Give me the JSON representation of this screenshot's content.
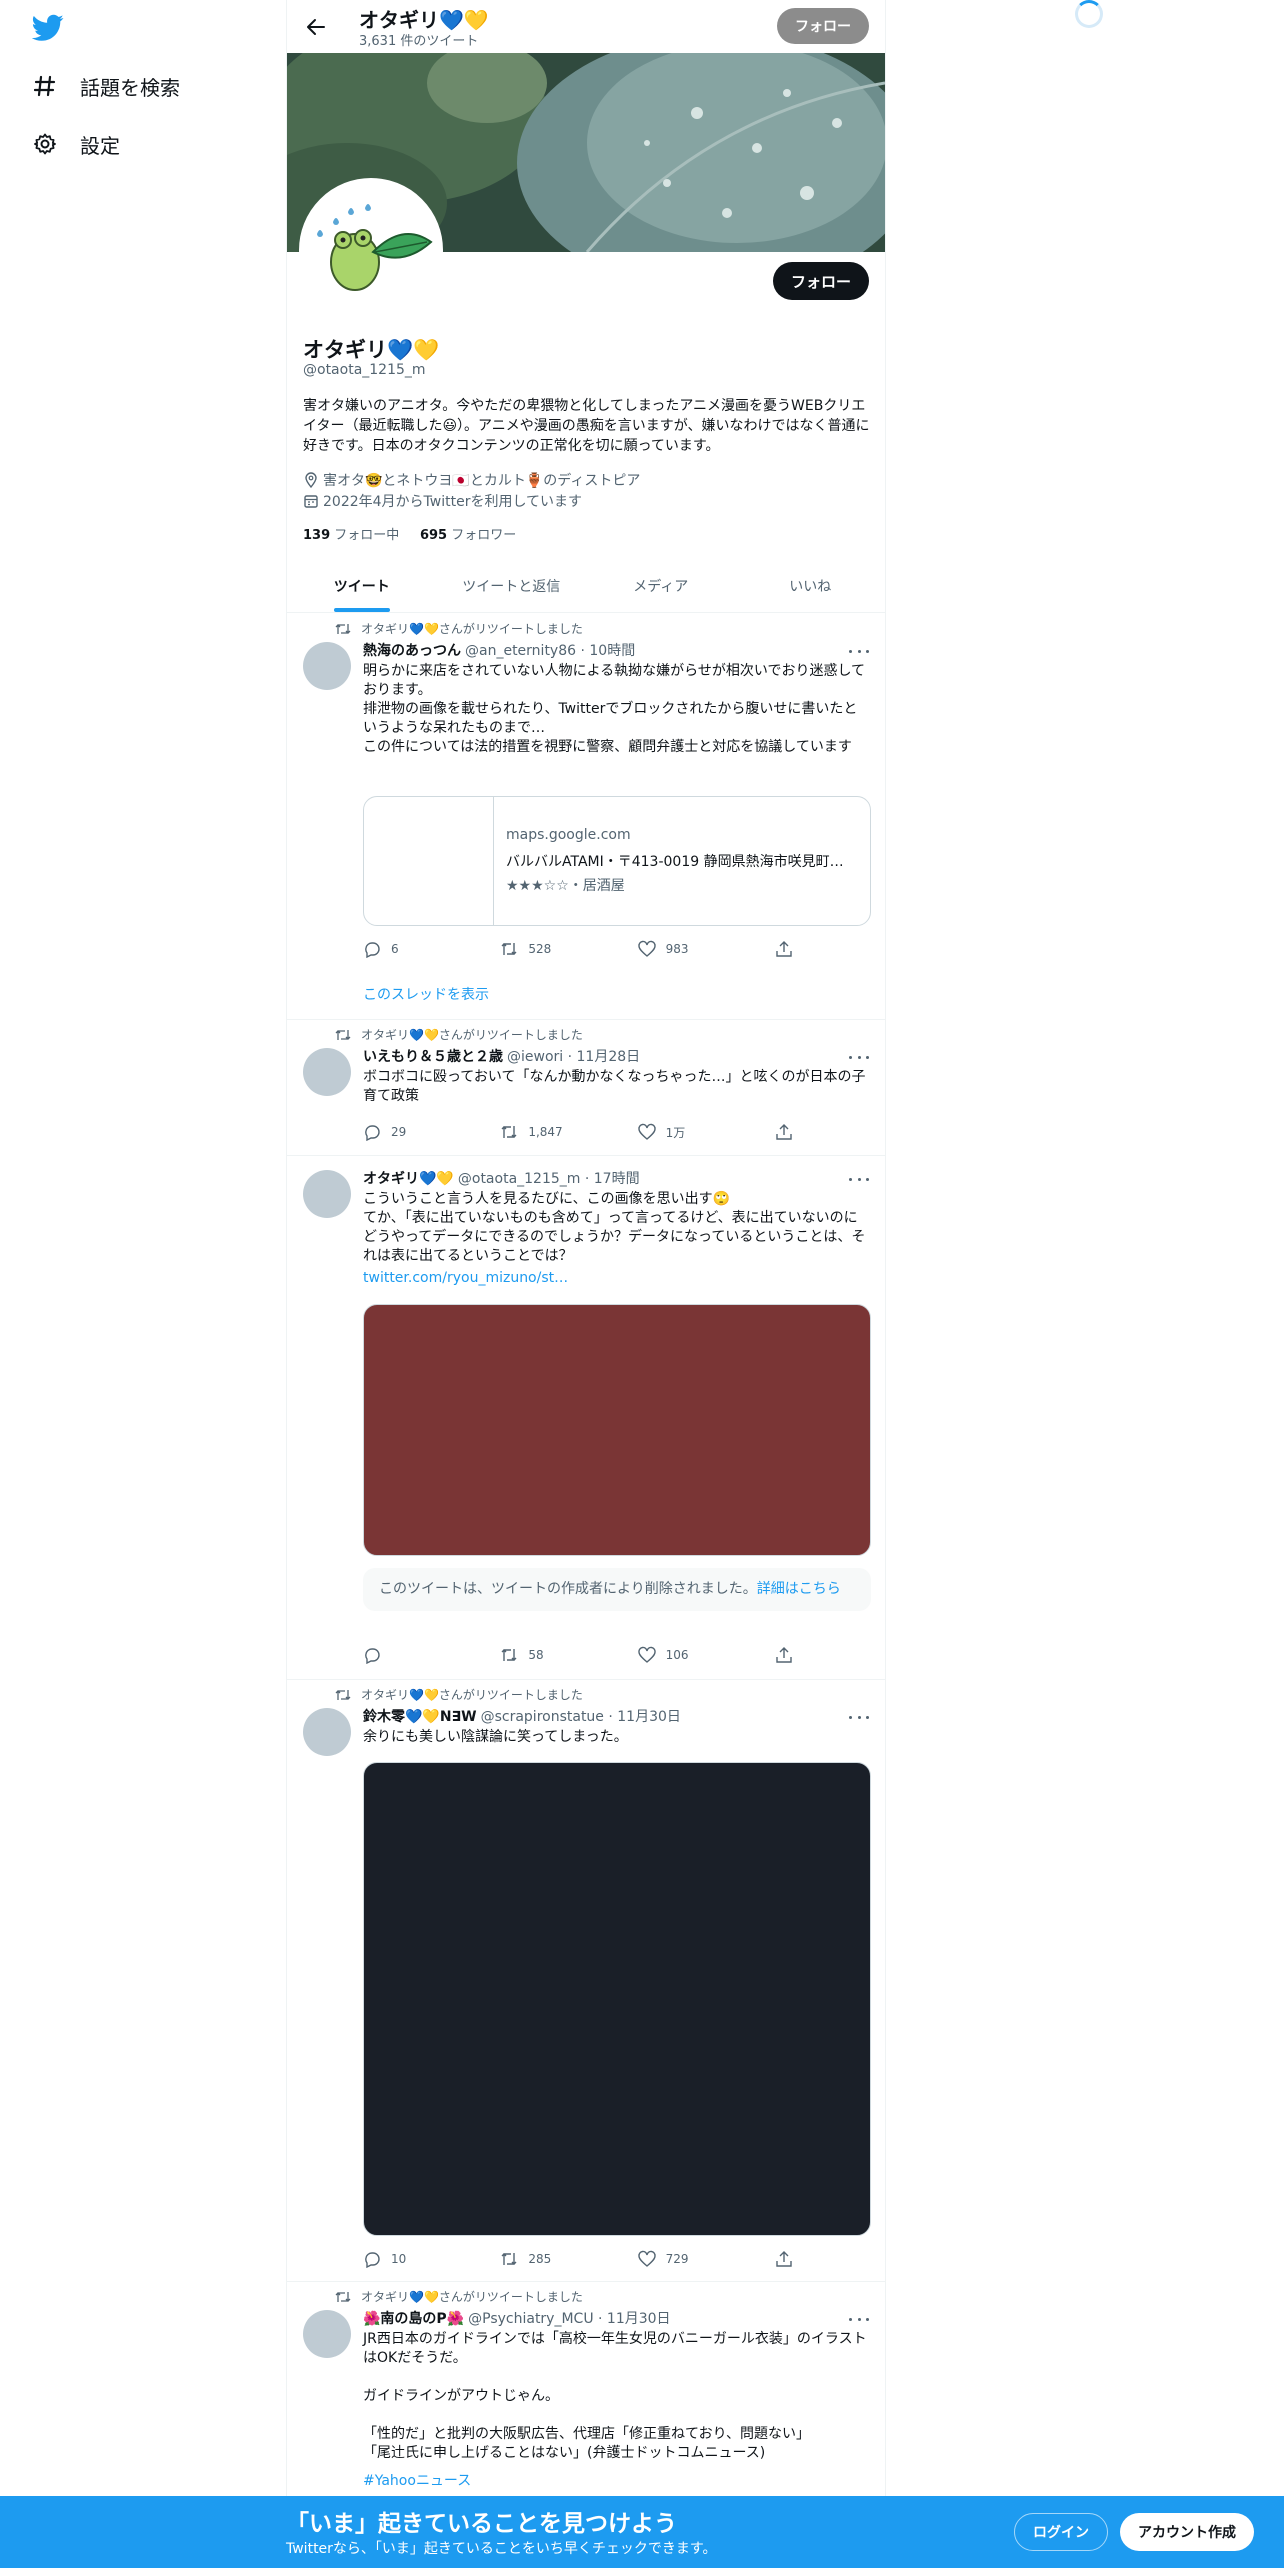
{
  "nav": {
    "explore_label": "話題を検索",
    "settings_label": "設定"
  },
  "topbar": {
    "name": "オタギリ💙💛",
    "tweet_count": "3,631 件のツイート",
    "follow_label": "フォロー"
  },
  "profile": {
    "follow_label": "フォロー",
    "name": "オタギリ💙💛",
    "handle": "@otaota_1215_m",
    "bio": "害オタ嫌いのアニオタ。今やただの卑猥物と化してしまったアニメ漫画を憂うWEBクリエイター（最近転職した😃）。アニメや漫画の愚痴を言いますが、嫌いなわけではなく普通に好きです。日本のオタクコンテンツの正常化を切に願っています。",
    "location": "害オタ🤓とネトウヨ🇯🇵とカルト🏺のディストピア",
    "joined": "2022年4月からTwitterを利用しています",
    "following_count": "139",
    "following_label": "フォロー中",
    "followers_count": "695",
    "followers_label": "フォロワー"
  },
  "tabs": [
    "ツイート",
    "ツイートと返信",
    "メディア",
    "いいね"
  ],
  "tweets": [
    {
      "retweet_label": "オタギリ💙💛さんがリツイートしました",
      "name": "熱海のあっつん",
      "handle": "@an_eternity86 · 10時間",
      "text": "明らかに来店をされていない人物による執拗な嫌がらせが相次いでおり迷惑しております。\n排泄物の画像を載せられたり、Twitterでブロックされたから腹いせに書いたというような呆れたものまで…\nこの件については法的措置を視野に警察、顧問弁護士と対応を協議しています",
      "card_domain": "maps.google.com",
      "card_title": "バルバルATAMI・〒413-0019 静岡県熱海市咲見町…",
      "card_desc": "★★★☆☆・居酒屋",
      "replies": "6",
      "retweets": "528",
      "likes": "983",
      "thread_link": "このスレッドを表示"
    },
    {
      "retweet_label": "オタギリ💙💛さんがリツイートしました",
      "name": "いえもり＆５歳と２歳",
      "handle": "@iewori · 11月28日",
      "text": "ボコボコに殴っておいて「なんか動かなくなっちゃった…」と呟くのが日本の子育て政策",
      "replies": "29",
      "retweets": "1,847",
      "likes": "1万"
    },
    {
      "name": "オタギリ💙💛",
      "handle": "@otaota_1215_m · 17時間",
      "text": "こういうこと言う人を見るたびに、この画像を思い出す🙄\nてか、「表に出ていないものも含めて」って言ってるけど、表に出ていないのにどうやってデータにできるのでしょうか？データになっているということは、それは表に出てるということでは？",
      "link": "twitter.com/ryou_mizuno/st…",
      "media_color": "#7a3535",
      "deleted_text": "このツイートは、ツイートの作成者により削除されました。",
      "deleted_link": "詳細はこちら",
      "replies": "",
      "retweets": "58",
      "likes": "106"
    },
    {
      "retweet_label": "オタギリ💙💛さんがリツイートしました",
      "name": "鈴木零💙💛N∃W",
      "handle": "@scrapironstatue · 11月30日",
      "text": "余りにも美しい陰謀論に笑ってしまった。",
      "media_color": "#1a1f28",
      "replies": "10",
      "retweets": "285",
      "likes": "729"
    },
    {
      "retweet_label": "オタギリ💙💛さんがリツイートしました",
      "name": "🌺南の島のP🌺",
      "handle": "@Psychiatry_MCU · 11月30日",
      "text": "JR西日本のガイドラインでは「高校一年生女児のバニーガール衣装」のイラストはOKだそうだ。\n\nガイドラインがアウトじゃん。\n\n「性的だ」と批判の大阪駅広告、代理店「修正重ねており、問題ない」\n「尾辻氏に申し上げることはない」(弁護士ドットコムニュース)",
      "hashtag": "#Yahooニュース"
    }
  ],
  "bottom": {
    "title": "「いま」起きていることを見つけよう",
    "subtitle": "Twitterなら、「いま」起きていることをいち早くチェックできます。",
    "login_label": "ログイン",
    "signup_label": "アカウント作成"
  },
  "colors": {
    "accent": "#1d9bf0",
    "bottom_bar": "#1d9bf0",
    "topbar_follow": "#8c8c8c"
  },
  "icons": [
    "twitter-logo-icon",
    "hashtag-icon",
    "gear-icon",
    "back-arrow-icon",
    "location-icon",
    "calendar-icon",
    "retweet-icon",
    "reply-icon",
    "like-icon",
    "share-icon",
    "more-icon"
  ]
}
